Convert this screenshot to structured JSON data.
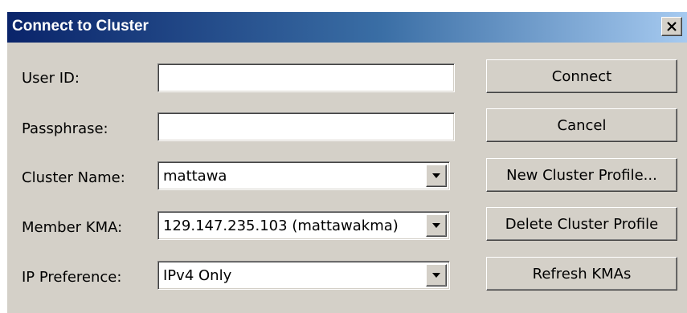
{
  "window": {
    "title": "Connect to Cluster",
    "close_icon": "close-x-icon"
  },
  "form": {
    "user_id_label": "User ID:",
    "user_id_value": "",
    "passphrase_label": "Passphrase:",
    "passphrase_value": "",
    "cluster_name_label": "Cluster Name:",
    "cluster_name_value": "mattawa",
    "member_kma_label": "Member KMA:",
    "member_kma_value": "129.147.235.103 (mattawakma)",
    "ip_preference_label": "IP Preference:",
    "ip_preference_value": "IPv4 Only",
    "dropdown_icon": "chevron-down-icon"
  },
  "buttons": {
    "connect": "Connect",
    "cancel": "Cancel",
    "new_profile": "New Cluster Profile...",
    "delete_profile": "Delete Cluster Profile",
    "refresh_kmas": "Refresh KMAs"
  },
  "colors": {
    "dialog_bg": "#d4d0c8",
    "title_start": "#0a246a",
    "title_end": "#a6caf0"
  }
}
